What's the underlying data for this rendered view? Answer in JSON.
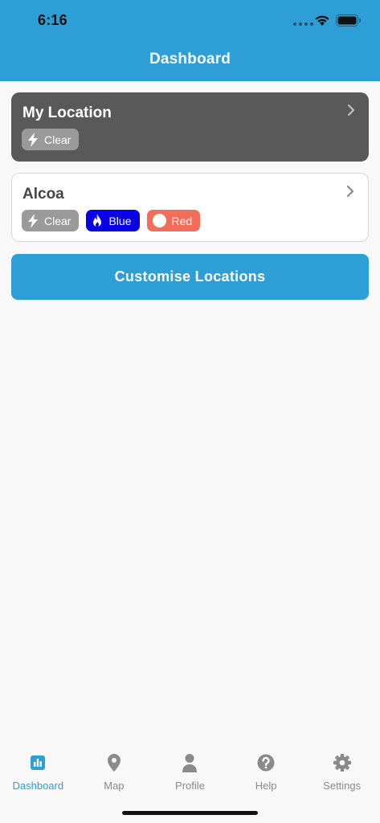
{
  "status": {
    "time": "6:16"
  },
  "header": {
    "title": "Dashboard"
  },
  "cards": [
    {
      "title": "My Location",
      "badges": [
        {
          "label": "Clear",
          "icon": "lightning-icon",
          "color": "#9a9a9a"
        }
      ]
    },
    {
      "title": "Alcoa",
      "badges": [
        {
          "label": "Clear",
          "icon": "lightning-icon",
          "color": "#9a9a9a"
        },
        {
          "label": "Blue",
          "icon": "flame-icon",
          "color": "#0a00e6"
        },
        {
          "label": "Red",
          "icon": "circle-icon",
          "color": "#f26d5a"
        }
      ]
    }
  ],
  "customise_button": {
    "label": "Customise Locations"
  },
  "tabbar": {
    "items": [
      {
        "label": "Dashboard",
        "icon": "bar-chart-icon",
        "active": true
      },
      {
        "label": "Map",
        "icon": "map-pin-icon",
        "active": false
      },
      {
        "label": "Profile",
        "icon": "person-icon",
        "active": false
      },
      {
        "label": "Help",
        "icon": "question-icon",
        "active": false
      },
      {
        "label": "Settings",
        "icon": "gear-icon",
        "active": false
      }
    ]
  },
  "colors": {
    "accent": "#2e9fd6",
    "dark_card": "#595959"
  }
}
